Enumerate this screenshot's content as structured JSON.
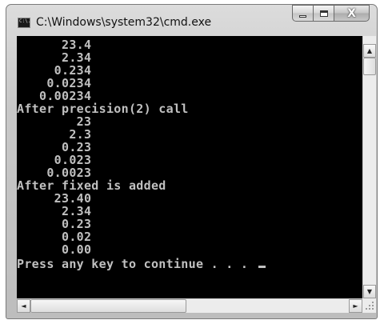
{
  "window": {
    "title": "C:\\Windows\\system32\\cmd.exe",
    "icon": "console-icon",
    "icon_glyph": "C:\\.",
    "buttons": {
      "minimize_icon": "minimize-icon",
      "maximize_icon": "maximize-icon",
      "close_icon": "close-icon",
      "close_glyph": "X"
    }
  },
  "console": {
    "background": "#000000",
    "foreground": "#c0c0c0",
    "lines": [
      "      23.4",
      "      2.34",
      "     0.234",
      "    0.0234",
      "   0.00234",
      "After precision(2) call",
      "        23",
      "       2.3",
      "      0.23",
      "     0.023",
      "    0.0023",
      "After fixed is added",
      "     23.40",
      "      2.34",
      "      0.23",
      "      0.02",
      "      0.00",
      "Press any key to continue . . . "
    ]
  },
  "scrollbars": {
    "up_arrow": "▲",
    "down_arrow": "▼",
    "left_arrow": "◄",
    "right_arrow": "►"
  }
}
